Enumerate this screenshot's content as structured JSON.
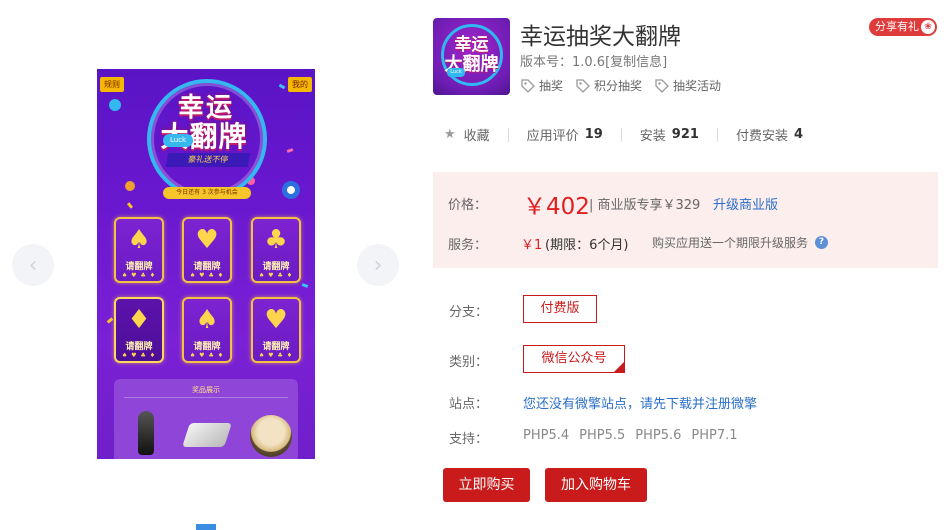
{
  "gallery": {
    "prev_icon": "chevron-left-icon",
    "next_icon": "chevron-right-icon",
    "screenshot": {
      "tag_left": "规则",
      "tag_right": "我的",
      "title_line1": "幸运",
      "title_line2": "大翻牌",
      "badge": "Luck",
      "ribbon": "豪礼送不停",
      "chance_text": "今日还有 3 次参与机会",
      "cards": [
        {
          "suit": "♠",
          "label": "请翻牌",
          "pips": "♠ ♥ ♣ ♦"
        },
        {
          "suit": "♥",
          "label": "请翻牌",
          "pips": "♠ ♥ ♣ ♦"
        },
        {
          "suit": "♣",
          "label": "请翻牌",
          "pips": "♠ ♥ ♣ ♦"
        },
        {
          "suit": "♦",
          "label": "请翻牌",
          "pips": "♠ ♥ ♣ ♦"
        },
        {
          "suit": "♠",
          "label": "请翻牌",
          "pips": "♠ ♥ ♣ ♦"
        },
        {
          "suit": "♥",
          "label": "请翻牌",
          "pips": "♠ ♥ ♣ ♦"
        }
      ],
      "prize_title": "奖品展示"
    }
  },
  "app": {
    "icon_line1": "幸运",
    "icon_line2": "大翻牌",
    "icon_tag": "Luck",
    "title": "幸运抽奖大翻牌",
    "version": "版本号：1.0.6[复制信息]",
    "tags": [
      "抽奖",
      "积分抽奖",
      "抽奖活动"
    ],
    "share_label": "分享有礼",
    "share_icon": "gift-icon"
  },
  "stats": {
    "favorite_label": "收藏",
    "rating_label": "应用评价",
    "rating_value": "19",
    "install_label": "安装",
    "install_value": "921",
    "paid_install_label": "付费安装",
    "paid_install_value": "4"
  },
  "pricing": {
    "price_label": "价格：",
    "price_value": "￥402",
    "price_extra": "| 商业版专享￥329",
    "upgrade_link": "升级商业版",
    "service_label": "服务：",
    "service_price": "￥1",
    "service_term": "(期限：6个月)",
    "service_note": "购买应用送一个期限升级服务",
    "help_icon": "?"
  },
  "options": {
    "branch_label": "分支：",
    "branch_value": "付费版",
    "category_label": "类别：",
    "category_value": "微信公众号",
    "site_label": "站点：",
    "site_value": "您还没有微擎站点，请先下载并注册微擎",
    "support_label": "支持：",
    "support_values": [
      "PHP5.4",
      "PHP5.5",
      "PHP5.6",
      "PHP7.1"
    ]
  },
  "actions": {
    "buy_label": "立即购买",
    "cart_label": "加入购物车"
  },
  "colors": {
    "accent_red": "#c91b1b",
    "price_red": "#e02020",
    "link_blue": "#2a6fc9",
    "price_bg": "#fdeeee"
  }
}
